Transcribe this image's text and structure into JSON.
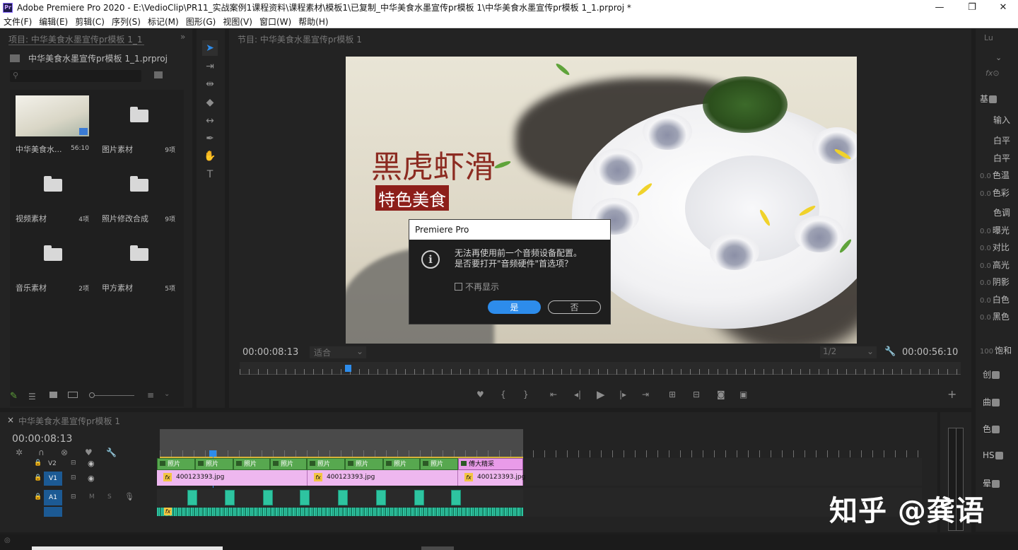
{
  "app": {
    "title": "Adobe Premiere Pro 2020 - E:\\VedioClip\\PR11_实战案例1课程资料\\课程素材\\模板1\\已复制_中华美食水墨宣传pr模板 1\\中华美食水墨宣传pr模板 1_1.prproj *",
    "logo_text": "Pr",
    "minimize": "—",
    "maximize": "❐",
    "close": "✕"
  },
  "menu": [
    "文件(F)",
    "编辑(E)",
    "剪辑(C)",
    "序列(S)",
    "标记(M)",
    "图形(G)",
    "视图(V)",
    "窗口(W)",
    "帮助(H)"
  ],
  "project": {
    "tab": "项目: 中华美食水墨宣传pr模板 1_1",
    "file": "中华美食水墨宣传pr模板 1_1.prproj",
    "items": [
      {
        "name": "中华美食水...",
        "count": "56:10"
      },
      {
        "name": "图片素材",
        "count": "9项"
      },
      {
        "name": "视频素材",
        "count": "4项"
      },
      {
        "name": "照片修改合成",
        "count": "9项"
      },
      {
        "name": "音乐素材",
        "count": "2项"
      },
      {
        "name": "甲方素材",
        "count": "5项"
      }
    ]
  },
  "program": {
    "tab": "节目: 中华美食水墨宣传pr模板 1",
    "slogan": "黑虎虾滑",
    "subtitle": "特色美食",
    "timecode_left": "00:00:08:13",
    "fit": "适合",
    "quality": "1/2",
    "timecode_right": "00:00:56:10",
    "playhead_fraction": 0.15
  },
  "dialog": {
    "title": "Premiere Pro",
    "icon": "i",
    "line1": "无法再使用前一个音频设备配置。",
    "line2": "是否要打开\"音频硬件\"首选项？",
    "checkbox": "不再显示",
    "yes": "是",
    "no": "否"
  },
  "timeline": {
    "tab": "中华美食水墨宣传pr模板 1",
    "timecode": "00:00:08:13",
    "tracks": {
      "v2": "V2",
      "v1": "V1",
      "a1": "A1",
      "mute": "M",
      "solo": "S"
    },
    "v2_clips": [
      "照片",
      "照片",
      "照片",
      "照片",
      "照片",
      "照片",
      "照片",
      "照片",
      "傅大精采"
    ],
    "v1_clips": [
      "400123393.jpg",
      "400123393.jpg",
      "400123393.jpg"
    ],
    "fx_label": "fx"
  },
  "lumetri": {
    "tab": "Lu",
    "items": [
      {
        "num": "",
        "label": "基"
      },
      {
        "num": "",
        "label": "输入"
      },
      {
        "num": "",
        "label": "白平"
      },
      {
        "num": "",
        "label": "白平"
      },
      {
        "num": "0.0",
        "label": "色温"
      },
      {
        "num": "0.0",
        "label": "色彩"
      },
      {
        "num": "",
        "label": "色调"
      },
      {
        "num": "0.0",
        "label": "曝光"
      },
      {
        "num": "0.0",
        "label": "对比"
      },
      {
        "num": "0.0",
        "label": "高光"
      },
      {
        "num": "0.0",
        "label": "阴影"
      },
      {
        "num": "0.0",
        "label": "白色"
      },
      {
        "num": "0.0",
        "label": "黑色"
      },
      {
        "num": "100",
        "label": "饱和"
      },
      {
        "num": "",
        "label": "创"
      },
      {
        "num": "",
        "label": "曲"
      },
      {
        "num": "",
        "label": "色"
      },
      {
        "num": "",
        "label": "HS"
      },
      {
        "num": "",
        "label": "晕"
      }
    ]
  },
  "watermark": "知乎 @龚语"
}
